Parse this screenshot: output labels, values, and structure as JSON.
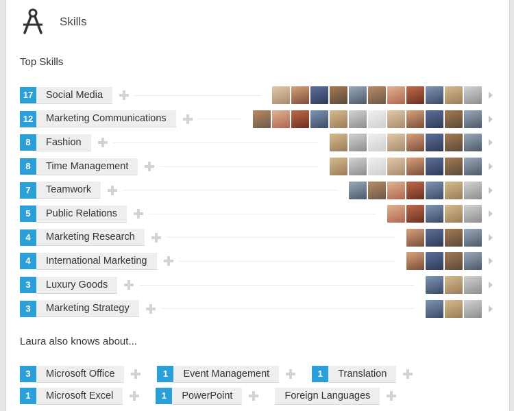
{
  "header": {
    "title": "Skills",
    "icon": "compass-icon"
  },
  "top_skills_title": "Top Skills",
  "also_knows_title": "Laura also knows about...",
  "colors": {
    "count_badge": "#2a9fd8",
    "name_pill": "#eeeeee",
    "plus": "#d3d3d3"
  },
  "skills": [
    {
      "count": "17",
      "name": "Social Media",
      "endorsers": 11
    },
    {
      "count": "12",
      "name": "Marketing Communications",
      "endorsers": 12
    },
    {
      "count": "8",
      "name": "Fashion",
      "endorsers": 8
    },
    {
      "count": "8",
      "name": "Time Management",
      "endorsers": 8
    },
    {
      "count": "7",
      "name": "Teamwork",
      "endorsers": 7
    },
    {
      "count": "5",
      "name": "Public Relations",
      "endorsers": 5
    },
    {
      "count": "4",
      "name": "Marketing Research",
      "endorsers": 4
    },
    {
      "count": "4",
      "name": "International Marketing",
      "endorsers": 4
    },
    {
      "count": "3",
      "name": "Luxury Goods",
      "endorsers": 3
    },
    {
      "count": "3",
      "name": "Marketing Strategy",
      "endorsers": 3
    }
  ],
  "also_knows_rows": [
    [
      {
        "count": "3",
        "name": "Microsoft Office"
      },
      {
        "count": "1",
        "name": "Event Management"
      },
      {
        "count": "1",
        "name": "Translation"
      }
    ],
    [
      {
        "count": "1",
        "name": "Microsoft Excel"
      },
      {
        "count": "1",
        "name": "PowerPoint"
      },
      {
        "count": "",
        "name": "Foreign Languages"
      }
    ]
  ]
}
